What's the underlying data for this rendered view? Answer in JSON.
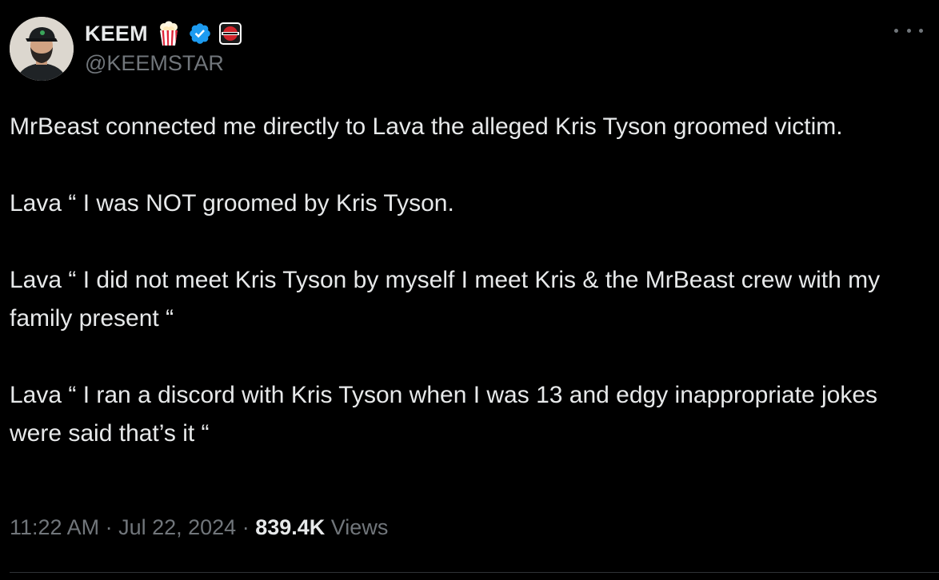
{
  "author": {
    "display_name": "KEEM",
    "handle": "@KEEMSTAR",
    "badges": [
      "popcorn-icon",
      "verified-badge-icon",
      "drama-alert-affiliate-icon"
    ],
    "verified_color": "#1d9bf0"
  },
  "post": {
    "paragraphs": [
      "MrBeast connected me directly to Lava the alleged Kris Tyson groomed victim.",
      "Lava “ I was NOT groomed by Kris Tyson.",
      "Lava “ I did not meet Kris Tyson by myself I meet Kris & the MrBeast crew with my family present “",
      "Lava “ I ran a discord with Kris Tyson when I was 13 and edgy inappropriate jokes were said that’s it “"
    ]
  },
  "meta": {
    "time": "11:22 AM",
    "separator": " · ",
    "date": "Jul 22, 2024",
    "views_count": "839.4K",
    "views_label": " Views"
  },
  "colors": {
    "background": "#000000",
    "text": "#e7e9ea",
    "secondary_text": "#71767b",
    "divider": "#2f3336"
  }
}
